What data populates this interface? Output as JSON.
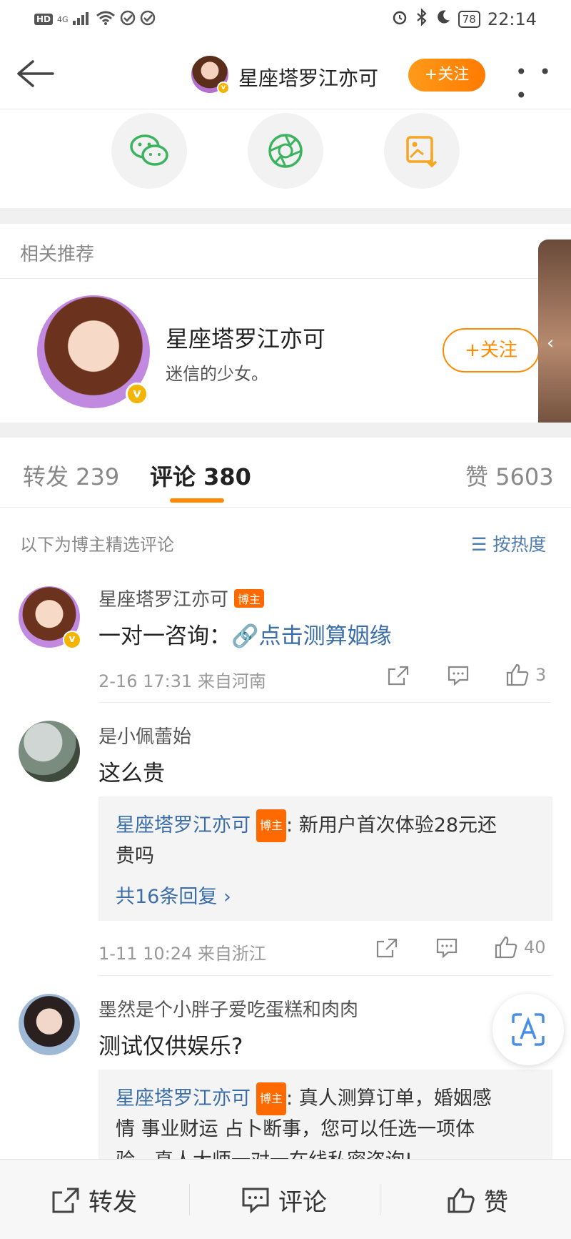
{
  "status_bar": {
    "hd": "HD",
    "network": "4G",
    "battery": "78",
    "time": "22:14"
  },
  "header": {
    "title": "星座塔罗江亦可",
    "follow_label": "+关注",
    "more_label": "• • •"
  },
  "recommend": {
    "section_title": "相关推荐",
    "name": "星座塔罗江亦可",
    "description": "迷信的少女。",
    "follow_label": "+关注"
  },
  "tabs": [
    {
      "label": "转发 239"
    },
    {
      "label": "评论 380"
    },
    {
      "label": "赞 5603"
    }
  ],
  "comments_header": {
    "left": "以下为博主精选评论",
    "sort_label": "按热度"
  },
  "comments": [
    {
      "name": "星座塔罗江亦可",
      "badge": "博主",
      "text_prefix": "一对一咨询：",
      "link_text": "点击测算姻缘",
      "meta": "2-16 17:31  来自河南",
      "likes": "3"
    },
    {
      "name": "是小佩蕾始",
      "text": "这么贵",
      "reply_name": "星座塔罗江亦可",
      "reply_badge": "博主",
      "reply_text_1": ": 新用户首次体验28元还",
      "reply_text_2": "贵吗",
      "reply_more": "共16条回复 ›",
      "meta": "1-11 10:24  来自浙江",
      "likes": "40"
    },
    {
      "name": "墨然是个小胖子爱吃蛋糕和肉肉",
      "text": "测试仅供娱乐?",
      "reply_name": "星座塔罗江亦可",
      "reply_badge": "博主",
      "reply_text_1": ": 真人测算订单，婚姻感",
      "reply_text_2": "情  事业财运  占卜断事，您可以任选一项体",
      "reply_text_3": "验，真人大师一对一在线私密咨询!"
    }
  ],
  "bottom_bar": {
    "repost": "转发",
    "comment": "评论",
    "like": "赞"
  }
}
